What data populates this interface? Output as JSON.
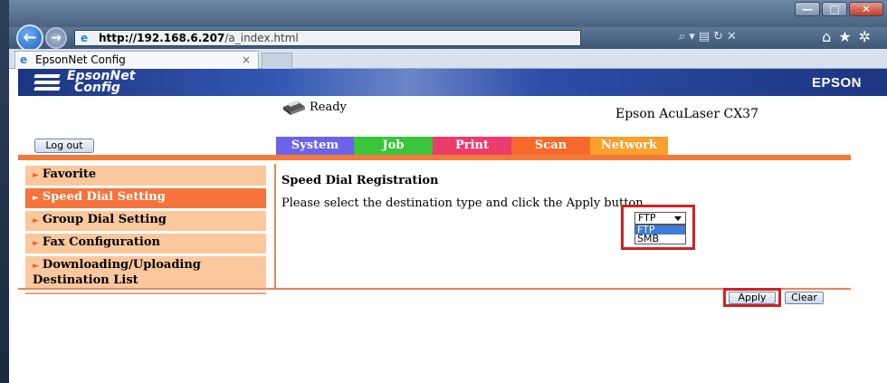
{
  "browser": {
    "address": {
      "host": "http://192.168.6.207",
      "path": "/a_index.html"
    },
    "tab_title": "EpsonNet Config",
    "tab_close": "×",
    "window_buttons": {
      "minimize": "—",
      "maximize": "□",
      "close": "✕"
    }
  },
  "header": {
    "logo_line1": "EpsonNet",
    "logo_line2": "Config",
    "brand": "EPSON"
  },
  "status": {
    "text": "Ready",
    "model": "Epson AcuLaser CX37"
  },
  "logout_label": "Log out",
  "menu": [
    {
      "label": "System",
      "color": "#6b63e8"
    },
    {
      "label": "Job",
      "color": "#39c53c"
    },
    {
      "label": "Print",
      "color": "#ec3c6c"
    },
    {
      "label": "Scan",
      "color": "#f56a2b"
    },
    {
      "label": "Network",
      "color": "#f7a02c"
    }
  ],
  "sidebar": [
    {
      "label": "Favorite",
      "active": false
    },
    {
      "label": "Speed Dial Setting",
      "active": true
    },
    {
      "label": "Group Dial Setting",
      "active": false
    },
    {
      "label": "Fax Configuration",
      "active": false
    },
    {
      "label": "Downloading/Uploading Destination List",
      "active": false
    }
  ],
  "content": {
    "title": "Speed Dial Registration",
    "instruction": "Please select the destination type and click the Apply button.",
    "destination_type": {
      "selected": "FTP",
      "options": [
        "FTP",
        "SMB"
      ]
    }
  },
  "buttons": {
    "apply": "Apply",
    "clear": "Clear"
  },
  "colors": {
    "accent_orange": "#f47a3a",
    "sidebar_bg": "#fbc89e",
    "banner_blue": "#1c3580",
    "highlight_red": "#d32020"
  }
}
